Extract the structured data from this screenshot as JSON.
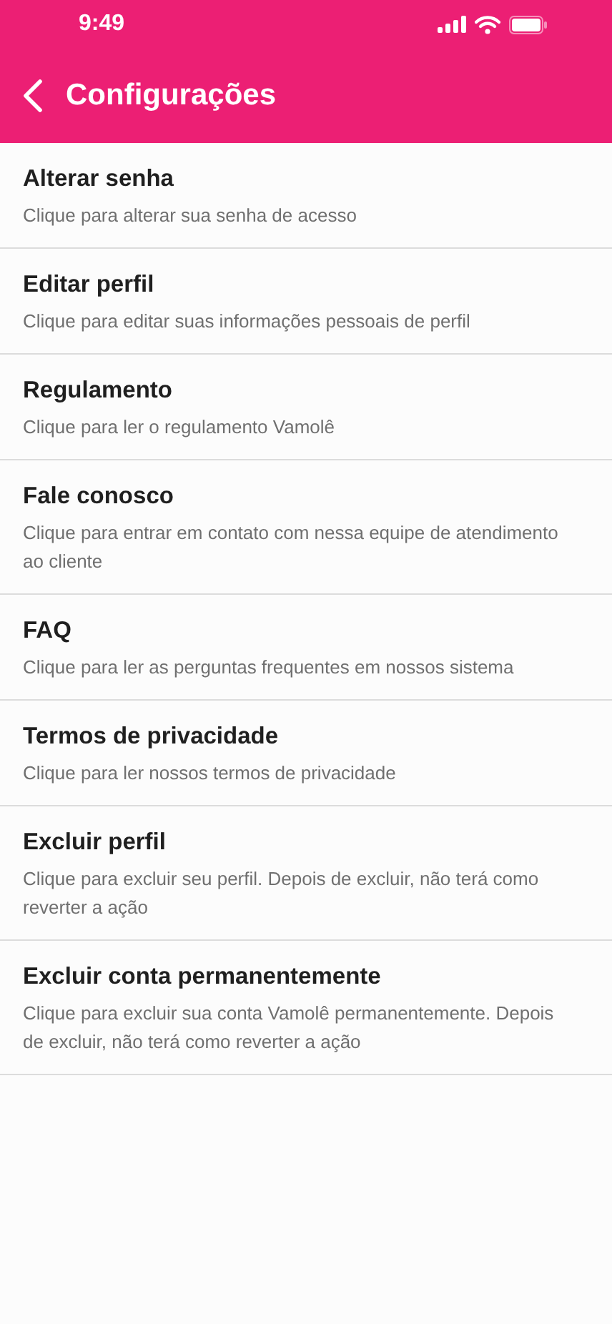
{
  "status_bar": {
    "time": "9:49"
  },
  "header": {
    "title": "Configurações"
  },
  "items": [
    {
      "title": "Alterar senha",
      "description": "Clique para alterar sua senha de acesso"
    },
    {
      "title": "Editar perfil",
      "description": "Clique para editar suas informações pessoais de perfil"
    },
    {
      "title": "Regulamento",
      "description": "Clique para ler o regulamento Vamolê"
    },
    {
      "title": "Fale conosco",
      "description": "Clique para entrar em contato com nessa equipe de atendimento ao cliente"
    },
    {
      "title": "FAQ",
      "description": "Clique para ler as perguntas frequentes em nossos sistema"
    },
    {
      "title": "Termos de privacidade",
      "description": "Clique para ler nossos termos de privacidade"
    },
    {
      "title": "Excluir perfil",
      "description": "Clique para excluir seu perfil. Depois de excluir, não terá como reverter a ação"
    },
    {
      "title": "Excluir conta permanentemente",
      "description": "Clique para excluir sua conta Vamolê permanentemente. Depois de excluir, não terá como reverter a ação"
    }
  ]
}
